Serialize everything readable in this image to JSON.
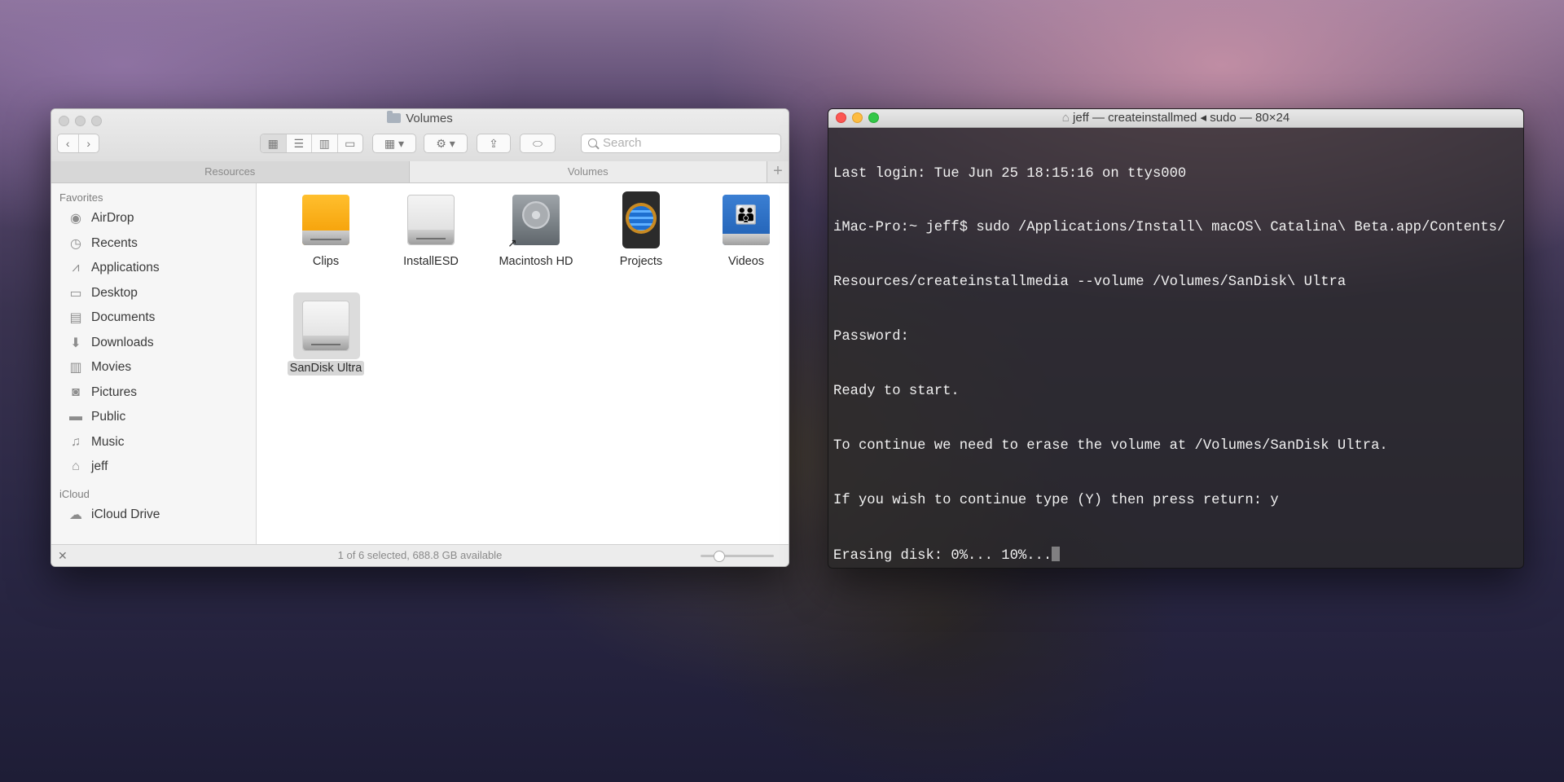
{
  "finder": {
    "title": "Volumes",
    "search_placeholder": "Search",
    "tabs": [
      {
        "label": "Resources",
        "active": false
      },
      {
        "label": "Volumes",
        "active": true
      }
    ],
    "tab_add": "+",
    "sidebar": {
      "favorites_header": "Favorites",
      "favorites": [
        {
          "label": "AirDrop",
          "icon": "airdrop-icon"
        },
        {
          "label": "Recents",
          "icon": "clock-icon"
        },
        {
          "label": "Applications",
          "icon": "applications-icon"
        },
        {
          "label": "Desktop",
          "icon": "desktop-icon"
        },
        {
          "label": "Documents",
          "icon": "document-icon"
        },
        {
          "label": "Downloads",
          "icon": "download-icon"
        },
        {
          "label": "Movies",
          "icon": "film-icon"
        },
        {
          "label": "Pictures",
          "icon": "camera-icon"
        },
        {
          "label": "Public",
          "icon": "folder-icon"
        },
        {
          "label": "Music",
          "icon": "music-icon"
        },
        {
          "label": "jeff",
          "icon": "home-icon"
        }
      ],
      "icloud_header": "iCloud",
      "icloud": [
        {
          "label": "iCloud Drive",
          "icon": "cloud-icon"
        }
      ]
    },
    "volumes": [
      {
        "label": "Clips",
        "icon": "orange-drive-icon",
        "selected": false
      },
      {
        "label": "InstallESD",
        "icon": "white-drive-icon",
        "selected": false
      },
      {
        "label": "Macintosh HD",
        "icon": "hard-disk-icon",
        "selected": false
      },
      {
        "label": "Projects",
        "icon": "globe-drive-icon",
        "selected": false
      },
      {
        "label": "Videos",
        "icon": "network-share-icon",
        "selected": false
      },
      {
        "label": "SanDisk Ultra",
        "icon": "external-drive-icon",
        "selected": true
      }
    ],
    "status": "1 of 6 selected, 688.8 GB available"
  },
  "terminal": {
    "title": "jeff — createinstallmed ◂ sudo — 80×24",
    "lines": [
      "Last login: Tue Jun 25 18:15:16 on ttys000",
      "iMac-Pro:~ jeff$ sudo /Applications/Install\\ macOS\\ Catalina\\ Beta.app/Contents/",
      "Resources/createinstallmedia --volume /Volumes/SanDisk\\ Ultra",
      "Password:",
      "Ready to start.",
      "To continue we need to erase the volume at /Volumes/SanDisk Ultra.",
      "If you wish to continue type (Y) then press return: y",
      "Erasing disk: 0%... 10%..."
    ]
  },
  "colors": {
    "close": "#fc5753",
    "minimize": "#fdbc40",
    "zoom": "#33c748"
  }
}
